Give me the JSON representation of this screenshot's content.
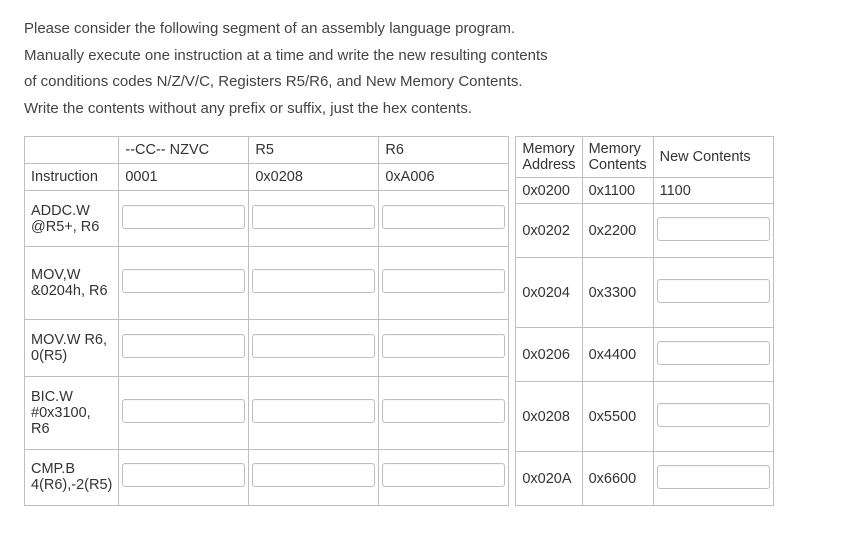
{
  "prompt": {
    "l1": "Please consider the following  segment of an assembly language program.",
    "l2": "Manually execute one instruction at a time and write the new resulting contents",
    "l3": "of conditions codes N/Z/V/C, Registers R5/R6, and New Memory Contents.",
    "l4": "Write the contents without any prefix or suffix, just the hex contents."
  },
  "left": {
    "head": {
      "instr": "",
      "cc": "--CC--  NZVC",
      "r5": "R5",
      "r6": "R6"
    },
    "rows": [
      {
        "instr": "Instruction",
        "cc": "0001",
        "r5": "0x0208",
        "r6": "0xA006",
        "editable": false
      },
      {
        "instr": "ADDC.W @R5+, R6",
        "editable": true
      },
      {
        "instr": "MOV,W &0204h, R6",
        "editable": true
      },
      {
        "instr": "MOV.W R6, 0(R5)",
        "editable": true
      },
      {
        "instr": "BIC.W #0x3100, R6",
        "editable": true
      },
      {
        "instr": "CMP.B 4(R6),-2(R5)",
        "editable": true
      }
    ]
  },
  "right": {
    "head": {
      "addr": "Memory Address",
      "cont": "Memory Contents",
      "new": "New Contents"
    },
    "rows": [
      {
        "addr": "0x0200",
        "cont": "0x1100",
        "new": "1100",
        "editable": false
      },
      {
        "addr": "0x0202",
        "cont": "0x2200",
        "editable": true
      },
      {
        "addr": "0x0204",
        "cont": "0x3300",
        "editable": true
      },
      {
        "addr": "0x0206",
        "cont": "0x4400",
        "editable": true
      },
      {
        "addr": "0x0208",
        "cont": "0x5500",
        "editable": true
      },
      {
        "addr": "0x020A",
        "cont": "0x6600",
        "editable": true
      }
    ]
  }
}
